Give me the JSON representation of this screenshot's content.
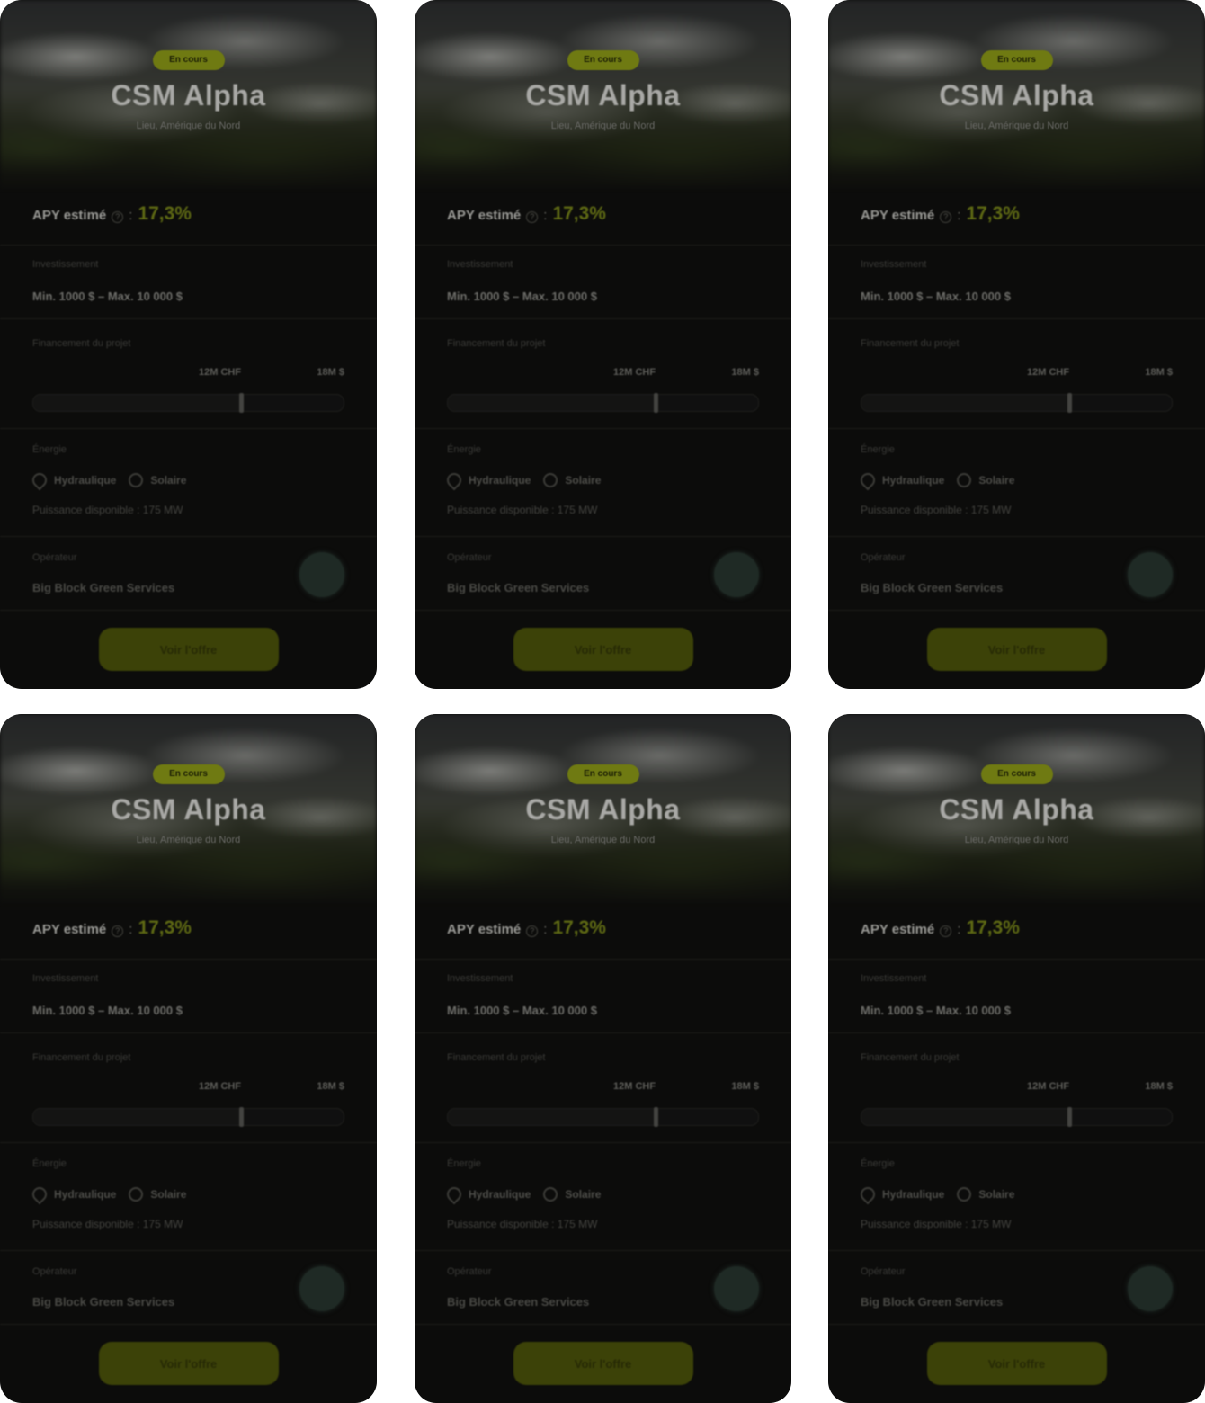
{
  "cards": [
    {
      "badge": "En cours",
      "title": "CSM Alpha",
      "subtitle": "Lieu, Amérique du Nord",
      "apy_label": "APY estimé",
      "apy_info": "?",
      "apy_colon": ":",
      "apy_value": "17,3%",
      "investment_label": "Investissement",
      "investment_value": "Min. 1000 $ – Max. 10 000 $",
      "funding_label": "Financement du projet",
      "funding_raised": "12M CHF",
      "funding_goal": "18M $",
      "funding_progress_pct": 67,
      "energy_label": "Énergie",
      "energy_types": [
        "Hydraulique",
        "Solaire"
      ],
      "power_text": "Puissance disponible : 175 MW",
      "operator_label": "Opérateur",
      "operator_name": "Big Block Green Services",
      "cta_label": "Voir l'offre"
    },
    {
      "badge": "En cours",
      "title": "CSM Alpha",
      "subtitle": "Lieu, Amérique du Nord",
      "apy_label": "APY estimé",
      "apy_info": "?",
      "apy_colon": ":",
      "apy_value": "17,3%",
      "investment_label": "Investissement",
      "investment_value": "Min. 1000 $ – Max. 10 000 $",
      "funding_label": "Financement du projet",
      "funding_raised": "12M CHF",
      "funding_goal": "18M $",
      "funding_progress_pct": 67,
      "energy_label": "Énergie",
      "energy_types": [
        "Hydraulique",
        "Solaire"
      ],
      "power_text": "Puissance disponible : 175 MW",
      "operator_label": "Opérateur",
      "operator_name": "Big Block Green Services",
      "cta_label": "Voir l'offre"
    },
    {
      "badge": "En cours",
      "title": "CSM Alpha",
      "subtitle": "Lieu, Amérique du Nord",
      "apy_label": "APY estimé",
      "apy_info": "?",
      "apy_colon": ":",
      "apy_value": "17,3%",
      "investment_label": "Investissement",
      "investment_value": "Min. 1000 $ – Max. 10 000 $",
      "funding_label": "Financement du projet",
      "funding_raised": "12M CHF",
      "funding_goal": "18M $",
      "funding_progress_pct": 67,
      "energy_label": "Énergie",
      "energy_types": [
        "Hydraulique",
        "Solaire"
      ],
      "power_text": "Puissance disponible : 175 MW",
      "operator_label": "Opérateur",
      "operator_name": "Big Block Green Services",
      "cta_label": "Voir l'offre"
    },
    {
      "badge": "En cours",
      "title": "CSM Alpha",
      "subtitle": "Lieu, Amérique du Nord",
      "apy_label": "APY estimé",
      "apy_info": "?",
      "apy_colon": ":",
      "apy_value": "17,3%",
      "investment_label": "Investissement",
      "investment_value": "Min. 1000 $ – Max. 10 000 $",
      "funding_label": "Financement du projet",
      "funding_raised": "12M CHF",
      "funding_goal": "18M $",
      "funding_progress_pct": 67,
      "energy_label": "Énergie",
      "energy_types": [
        "Hydraulique",
        "Solaire"
      ],
      "power_text": "Puissance disponible : 175 MW",
      "operator_label": "Opérateur",
      "operator_name": "Big Block Green Services",
      "cta_label": "Voir l'offre"
    },
    {
      "badge": "En cours",
      "title": "CSM Alpha",
      "subtitle": "Lieu, Amérique du Nord",
      "apy_label": "APY estimé",
      "apy_info": "?",
      "apy_colon": ":",
      "apy_value": "17,3%",
      "investment_label": "Investissement",
      "investment_value": "Min. 1000 $ – Max. 10 000 $",
      "funding_label": "Financement du projet",
      "funding_raised": "12M CHF",
      "funding_goal": "18M $",
      "funding_progress_pct": 67,
      "energy_label": "Énergie",
      "energy_types": [
        "Hydraulique",
        "Solaire"
      ],
      "power_text": "Puissance disponible : 175 MW",
      "operator_label": "Opérateur",
      "operator_name": "Big Block Green Services",
      "cta_label": "Voir l'offre"
    },
    {
      "badge": "En cours",
      "title": "CSM Alpha",
      "subtitle": "Lieu, Amérique du Nord",
      "apy_label": "APY estimé",
      "apy_info": "?",
      "apy_colon": ":",
      "apy_value": "17,3%",
      "investment_label": "Investissement",
      "investment_value": "Min. 1000 $ – Max. 10 000 $",
      "funding_label": "Financement du projet",
      "funding_raised": "12M CHF",
      "funding_goal": "18M $",
      "funding_progress_pct": 67,
      "energy_label": "Énergie",
      "energy_types": [
        "Hydraulique",
        "Solaire"
      ],
      "power_text": "Puissance disponible : 175 MW",
      "operator_label": "Opérateur",
      "operator_name": "Big Block Green Services",
      "cta_label": "Voir l'offre"
    }
  ],
  "colors": {
    "accent": "#6f7a12",
    "card_background": "#0c0c0b",
    "page_background": "#ffffff",
    "cta_background": "#3c4208"
  }
}
